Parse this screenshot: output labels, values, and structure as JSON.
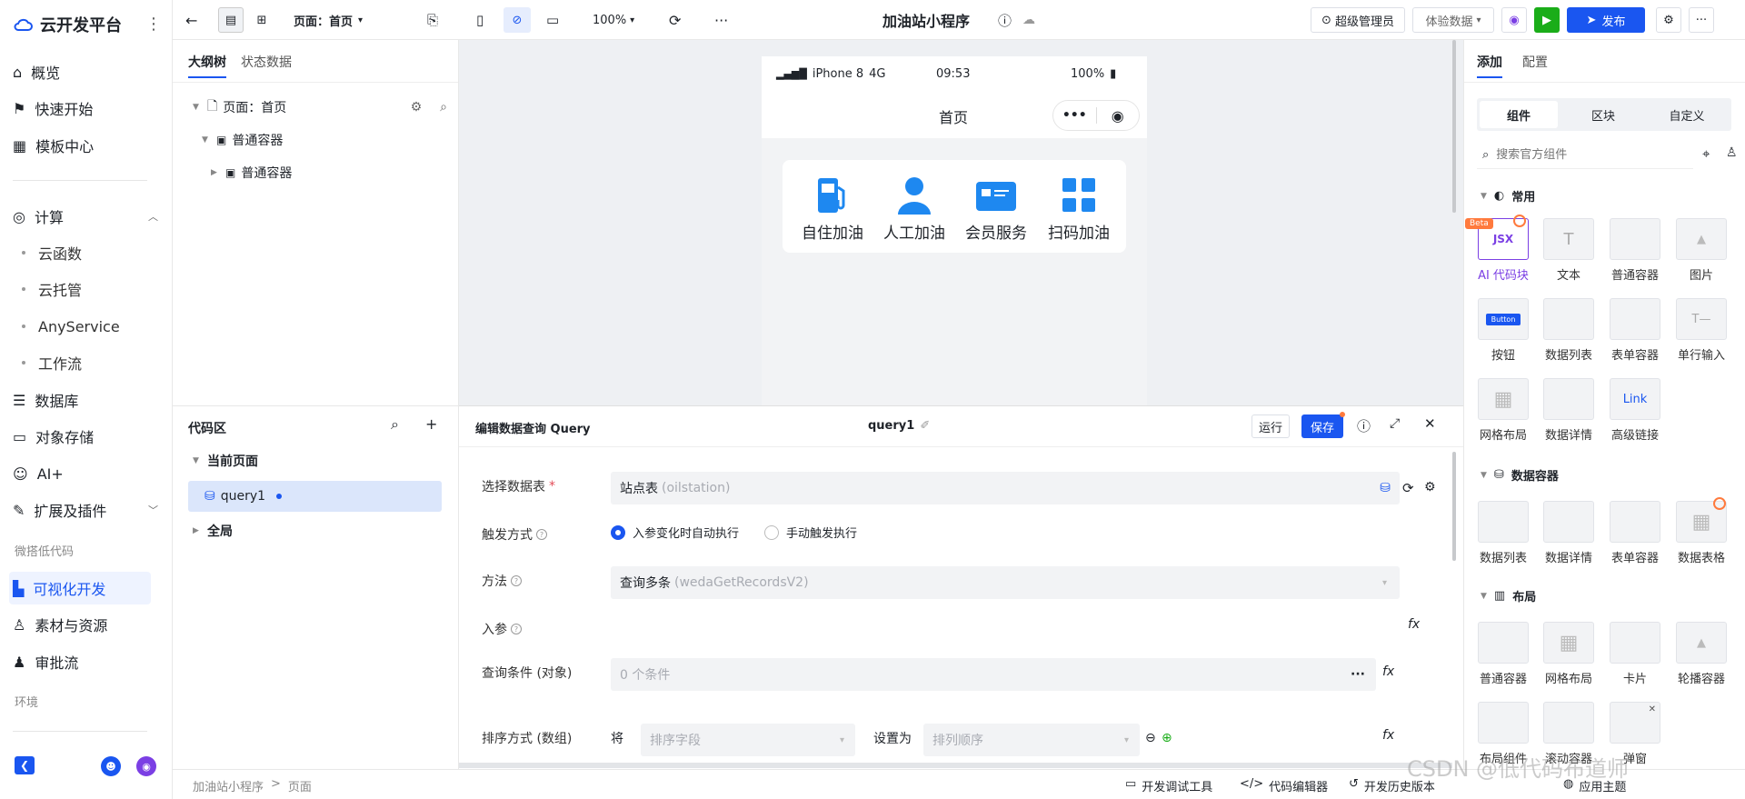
{
  "nav": {
    "logo": "云开发平台",
    "items": [
      {
        "label": "概览",
        "icon": "home-icon"
      },
      {
        "label": "快速开始",
        "icon": "flag-icon"
      },
      {
        "label": "模板中心",
        "icon": "template-icon"
      },
      {
        "label": "计算",
        "icon": "compute-icon"
      },
      {
        "label": "云函数"
      },
      {
        "label": "云托管"
      },
      {
        "label": "AnyService"
      },
      {
        "label": "工作流"
      },
      {
        "label": "数据库",
        "icon": "database-icon"
      },
      {
        "label": "对象存储",
        "icon": "folder-icon"
      },
      {
        "label": "AI+",
        "icon": "robot-icon"
      },
      {
        "label": "扩展及插件",
        "icon": "plugin-icon"
      },
      {
        "label": "可视化开发",
        "icon": "visual-dev-icon"
      },
      {
        "label": "素材与资源",
        "icon": "assets-icon"
      },
      {
        "label": "审批流",
        "icon": "approval-icon"
      }
    ],
    "section_lowcode": "微搭低代码",
    "section_env": "环境"
  },
  "topbar": {
    "page_selector": "页面：首页",
    "zoom": "100%",
    "app_title": "加油站小程序",
    "admin": "超级管理员",
    "env_selector": "体验数据",
    "publish": "发布"
  },
  "outline": {
    "tabs": [
      "大纲树",
      "状态数据"
    ],
    "page_node": "页面：首页",
    "nodes": [
      "普通容器",
      "普通容器"
    ]
  },
  "code": {
    "title": "代码区",
    "current_page": "当前页面",
    "query_item": "query1",
    "global": "全局"
  },
  "phone": {
    "device": "iPhone 8",
    "network": "4G",
    "time": "09:53",
    "battery": "100%",
    "page_title": "首页",
    "items": [
      {
        "label": "自住加油",
        "icon": "fuel-pump-icon"
      },
      {
        "label": "人工加油",
        "icon": "person-icon"
      },
      {
        "label": "会员服务",
        "icon": "member-card-icon"
      },
      {
        "label": "扫码加油",
        "icon": "grid-icon"
      }
    ]
  },
  "query": {
    "header_title": "编辑数据查询 Query",
    "name": "query1",
    "run": "运行",
    "save": "保存",
    "table_label": "选择数据表",
    "table_value": "站点表",
    "table_hint": "(oilstation)",
    "trigger_label": "触发方式",
    "trigger_auto": "入参变化时自动执行",
    "trigger_manual": "手动触发执行",
    "method_label": "方法",
    "method_value": "查询多条",
    "method_hint": "(wedaGetRecordsV2)",
    "params_label": "入参",
    "condition_label": "查询条件 (对象)",
    "condition_value": "0 个条件",
    "sort_label": "排序方式 (数组)",
    "sort_prefix": "将",
    "sort_field_placeholder": "排序字段",
    "sort_set": "设置为",
    "sort_order_placeholder": "排列顺序",
    "fx": "fx"
  },
  "right": {
    "tabs": [
      "添加",
      "配置"
    ],
    "segments": [
      "组件",
      "区块",
      "自定义"
    ],
    "search_placeholder": "搜索官方组件",
    "group_common": "常用",
    "group_data": "数据容器",
    "group_layout": "布局",
    "beta": "Beta",
    "jsx": "JSX",
    "button_preview": "Button",
    "link_preview": "Link",
    "common": [
      "AI 代码块",
      "文本",
      "普通容器",
      "图片",
      "按钮",
      "数据列表",
      "表单容器",
      "单行输入",
      "网格布局",
      "数据详情",
      "高级链接"
    ],
    "data": [
      "数据列表",
      "数据详情",
      "表单容器",
      "数据表格"
    ],
    "layout": [
      "普通容器",
      "网格布局",
      "卡片",
      "轮播容器",
      "布局组件",
      "滚动容器",
      "弹窗"
    ]
  },
  "status": {
    "breadcrumb": [
      "加油站小程序",
      "页面"
    ],
    "debug": "开发调试工具",
    "code_editor": "代码编辑器",
    "history": "开发历史版本",
    "theme": "应用主题",
    "watermark": "CSDN @低代码布道师"
  },
  "colors": {
    "accent": "#1a56f0",
    "green": "#1aad19",
    "jsx_purple": "#7b3fe4",
    "orange": "#ff7a3d"
  }
}
